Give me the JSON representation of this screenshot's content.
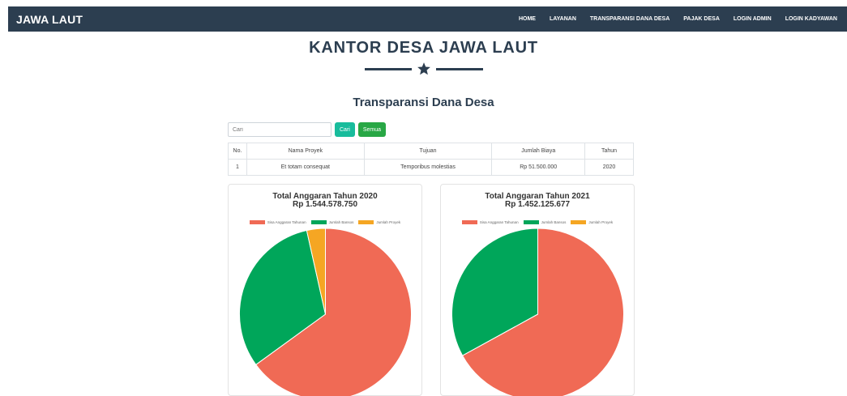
{
  "navbar": {
    "brand": "JAWA LAUT",
    "links": [
      "HOME",
      "LAYANAN",
      "TRANSPARANSI DANA DESA",
      "PAJAK DESA",
      "LOGIN ADMIN",
      "LOGIN KADYAWAN"
    ]
  },
  "header": {
    "title": "KANTOR DESA JAWA LAUT",
    "section_title": "Transparansi Dana Desa"
  },
  "search": {
    "placeholder": "Cari",
    "search_button": "Cari",
    "all_button": "Semua"
  },
  "table": {
    "columns": [
      "No.",
      "Nama Proyek",
      "Tujuan",
      "Jumlah Biaya",
      "Tahun"
    ],
    "rows": [
      [
        "1",
        "Et totam consequat",
        "Temporibus molestias",
        "Rp 51.500.000",
        "2020"
      ]
    ]
  },
  "colors": {
    "navbar": "#2c3e50",
    "sisa": "#f06a55",
    "bansos": "#00a65a",
    "proyek": "#f5a623",
    "search_button": "#18bc9c",
    "all_button": "#28a745"
  },
  "chart_data": [
    {
      "type": "pie",
      "title": "Total Anggaran Tahun 2020",
      "subtitle": "Rp 1.544.578.750",
      "legend_position": "top",
      "labels": [
        "Sisa Anggaran Tahunan",
        "Jumlah Bansos",
        "Jumlah Proyek"
      ],
      "values": [
        65,
        31.5,
        3.5
      ],
      "colors": [
        "#f06a55",
        "#00a65a",
        "#f5a623"
      ]
    },
    {
      "type": "pie",
      "title": "Total Anggaran Tahun 2021",
      "subtitle": "Rp 1.452.125.677",
      "legend_position": "top",
      "labels": [
        "Sisa Anggaran Tahunan",
        "Jumlah Bansos",
        "Jumlah Proyek"
      ],
      "values": [
        67,
        33,
        0
      ],
      "colors": [
        "#f06a55",
        "#00a65a",
        "#f5a623"
      ]
    }
  ]
}
